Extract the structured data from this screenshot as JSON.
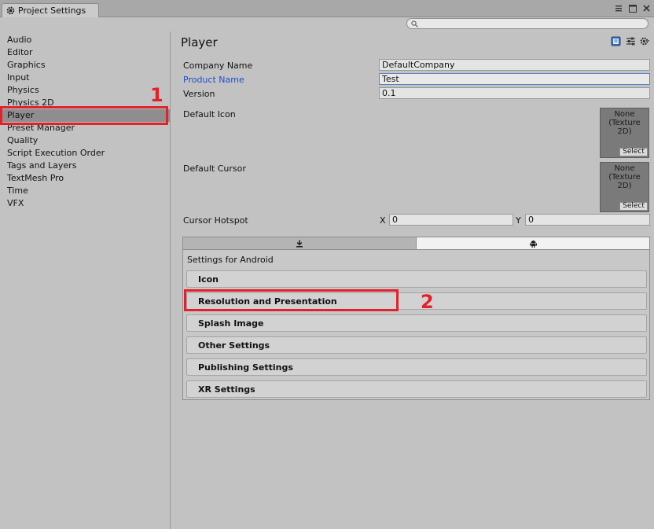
{
  "window": {
    "tab_title": "Project Settings",
    "controls": [
      "menu-icon",
      "maximize-icon",
      "close-icon"
    ]
  },
  "search": {
    "placeholder": "",
    "icon": "search-icon"
  },
  "sidebar": {
    "selected": "Player",
    "items": [
      {
        "label": "Audio"
      },
      {
        "label": "Editor"
      },
      {
        "label": "Graphics"
      },
      {
        "label": "Input"
      },
      {
        "label": "Physics"
      },
      {
        "label": "Physics 2D"
      },
      {
        "label": "Player"
      },
      {
        "label": "Preset Manager"
      },
      {
        "label": "Quality"
      },
      {
        "label": "Script Execution Order"
      },
      {
        "label": "Tags and Layers"
      },
      {
        "label": "TextMesh Pro"
      },
      {
        "label": "Time"
      },
      {
        "label": "VFX"
      }
    ]
  },
  "main": {
    "title": "Player",
    "header_icons": [
      "help-book-icon",
      "preset-sliders-icon",
      "gear-icon"
    ],
    "company_name_label": "Company Name",
    "company_name_value": "DefaultCompany",
    "product_name_label": "Product Name",
    "product_name_value": "Test",
    "version_label": "Version",
    "version_value": "0.1",
    "default_icon_label": "Default Icon",
    "default_cursor_label": "Default Cursor",
    "texture_none_text": "None\n(Texture\n2D)",
    "texture_select_label": "Select",
    "cursor_hotspot_label": "Cursor Hotspot",
    "hotspot_x_label": "X",
    "hotspot_x_value": "0",
    "hotspot_y_label": "Y",
    "hotspot_y_value": "0",
    "platform_tabs": [
      {
        "icon": "download-icon",
        "active": false
      },
      {
        "icon": "android-icon",
        "active": true
      }
    ],
    "settings_for": "Settings for Android",
    "sections": [
      {
        "label": "Icon"
      },
      {
        "label": "Resolution and Presentation"
      },
      {
        "label": "Splash Image"
      },
      {
        "label": "Other Settings"
      },
      {
        "label": "Publishing Settings"
      },
      {
        "label": "XR Settings"
      }
    ]
  },
  "annotations": {
    "step1": "1",
    "step2": "2",
    "color": "#e4212b"
  }
}
